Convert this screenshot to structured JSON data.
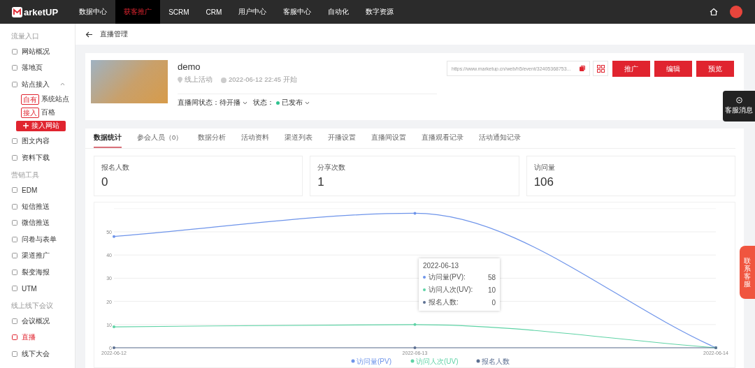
{
  "topbar": {
    "logo": "arketUP",
    "nav": [
      {
        "label": "数据中心",
        "selected": false
      },
      {
        "label": "获客推广",
        "selected": true
      },
      {
        "label": "SCRM",
        "selected": false
      },
      {
        "label": "CRM",
        "selected": false
      },
      {
        "label": "用户中心",
        "selected": false
      },
      {
        "label": "客服中心",
        "selected": false
      },
      {
        "label": "自动化",
        "selected": false
      },
      {
        "label": "数字资源",
        "selected": false
      }
    ]
  },
  "sidebar": {
    "sections": [
      {
        "title": "流量入口",
        "items": [
          {
            "label": "网站概况",
            "selected": false
          },
          {
            "label": "落地页",
            "selected": false
          },
          {
            "label": "站点接入",
            "selected": false,
            "expanded": true,
            "children": [
              {
                "badge": "自有",
                "label": "系统站点"
              },
              {
                "badge": "接入",
                "label": "百格"
              }
            ],
            "action": "接入网站"
          },
          {
            "label": "图文内容",
            "selected": false
          },
          {
            "label": "资料下载",
            "selected": false
          }
        ]
      },
      {
        "title": "营销工具",
        "items": [
          {
            "label": "EDM",
            "selected": false
          },
          {
            "label": "短信推送",
            "selected": false
          },
          {
            "label": "微信推送",
            "selected": false
          },
          {
            "label": "问卷与表单",
            "selected": false
          },
          {
            "label": "渠道推广",
            "selected": false
          },
          {
            "label": "裂变海报",
            "selected": false
          },
          {
            "label": "UTM",
            "selected": false
          }
        ]
      },
      {
        "title": "线上线下会议",
        "items": [
          {
            "label": "会议概况",
            "selected": false
          },
          {
            "label": "直播",
            "selected": true
          },
          {
            "label": "线下大会",
            "selected": false
          }
        ]
      }
    ]
  },
  "page_header": {
    "title": "直播管理"
  },
  "event": {
    "title": "demo",
    "location": "线上活动",
    "start": "2022-06-12 22:45 开始",
    "room_status": "直播间状态：待开播",
    "status_label": "状态：",
    "status": "已发布",
    "url": "https://www.marketup.cn/web/h5/event/32405368753...",
    "buttons": [
      "推广",
      "编辑",
      "预览"
    ]
  },
  "tabs": [
    {
      "label": "数据统计",
      "selected": true
    },
    {
      "label": "参会人员（0）",
      "selected": false
    },
    {
      "label": "数据分析",
      "selected": false
    },
    {
      "label": "活动资料",
      "selected": false
    },
    {
      "label": "渠道列表",
      "selected": false
    },
    {
      "label": "开播设置",
      "selected": false
    },
    {
      "label": "直播间设置",
      "selected": false
    },
    {
      "label": "直播观看记录",
      "selected": false
    },
    {
      "label": "活动通知记录",
      "selected": false
    }
  ],
  "stats": [
    {
      "label": "报名人数",
      "value": "0"
    },
    {
      "label": "分享次数",
      "value": "1"
    },
    {
      "label": "访问量",
      "value": "106"
    }
  ],
  "chart": {
    "chart_data": {
      "type": "line",
      "categories": [
        "2022-06-12",
        "2022-06-13",
        "2022-06-14"
      ],
      "series": [
        {
          "name": "访问量(PV)",
          "color": "#6e94ea",
          "values": [
            48,
            58,
            0
          ]
        },
        {
          "name": "访问人次(UV)",
          "color": "#5fd3a6",
          "values": [
            9,
            10,
            0
          ]
        },
        {
          "name": "报名人数",
          "color": "#5d7092",
          "values": [
            0,
            0,
            0
          ]
        }
      ],
      "ylim": [
        0,
        60
      ],
      "yticks": [
        0,
        10,
        20,
        30,
        40,
        50
      ],
      "grid": true
    },
    "tooltip": {
      "title": "2022-06-13",
      "rows": [
        {
          "label": "访问量(PV):",
          "value": "58"
        },
        {
          "label": "访问人次(UV):",
          "value": "10"
        },
        {
          "label": "报名人数:",
          "value": "0"
        }
      ]
    }
  },
  "widgets": {
    "message": "客服消息",
    "contact": "联系客服"
  }
}
